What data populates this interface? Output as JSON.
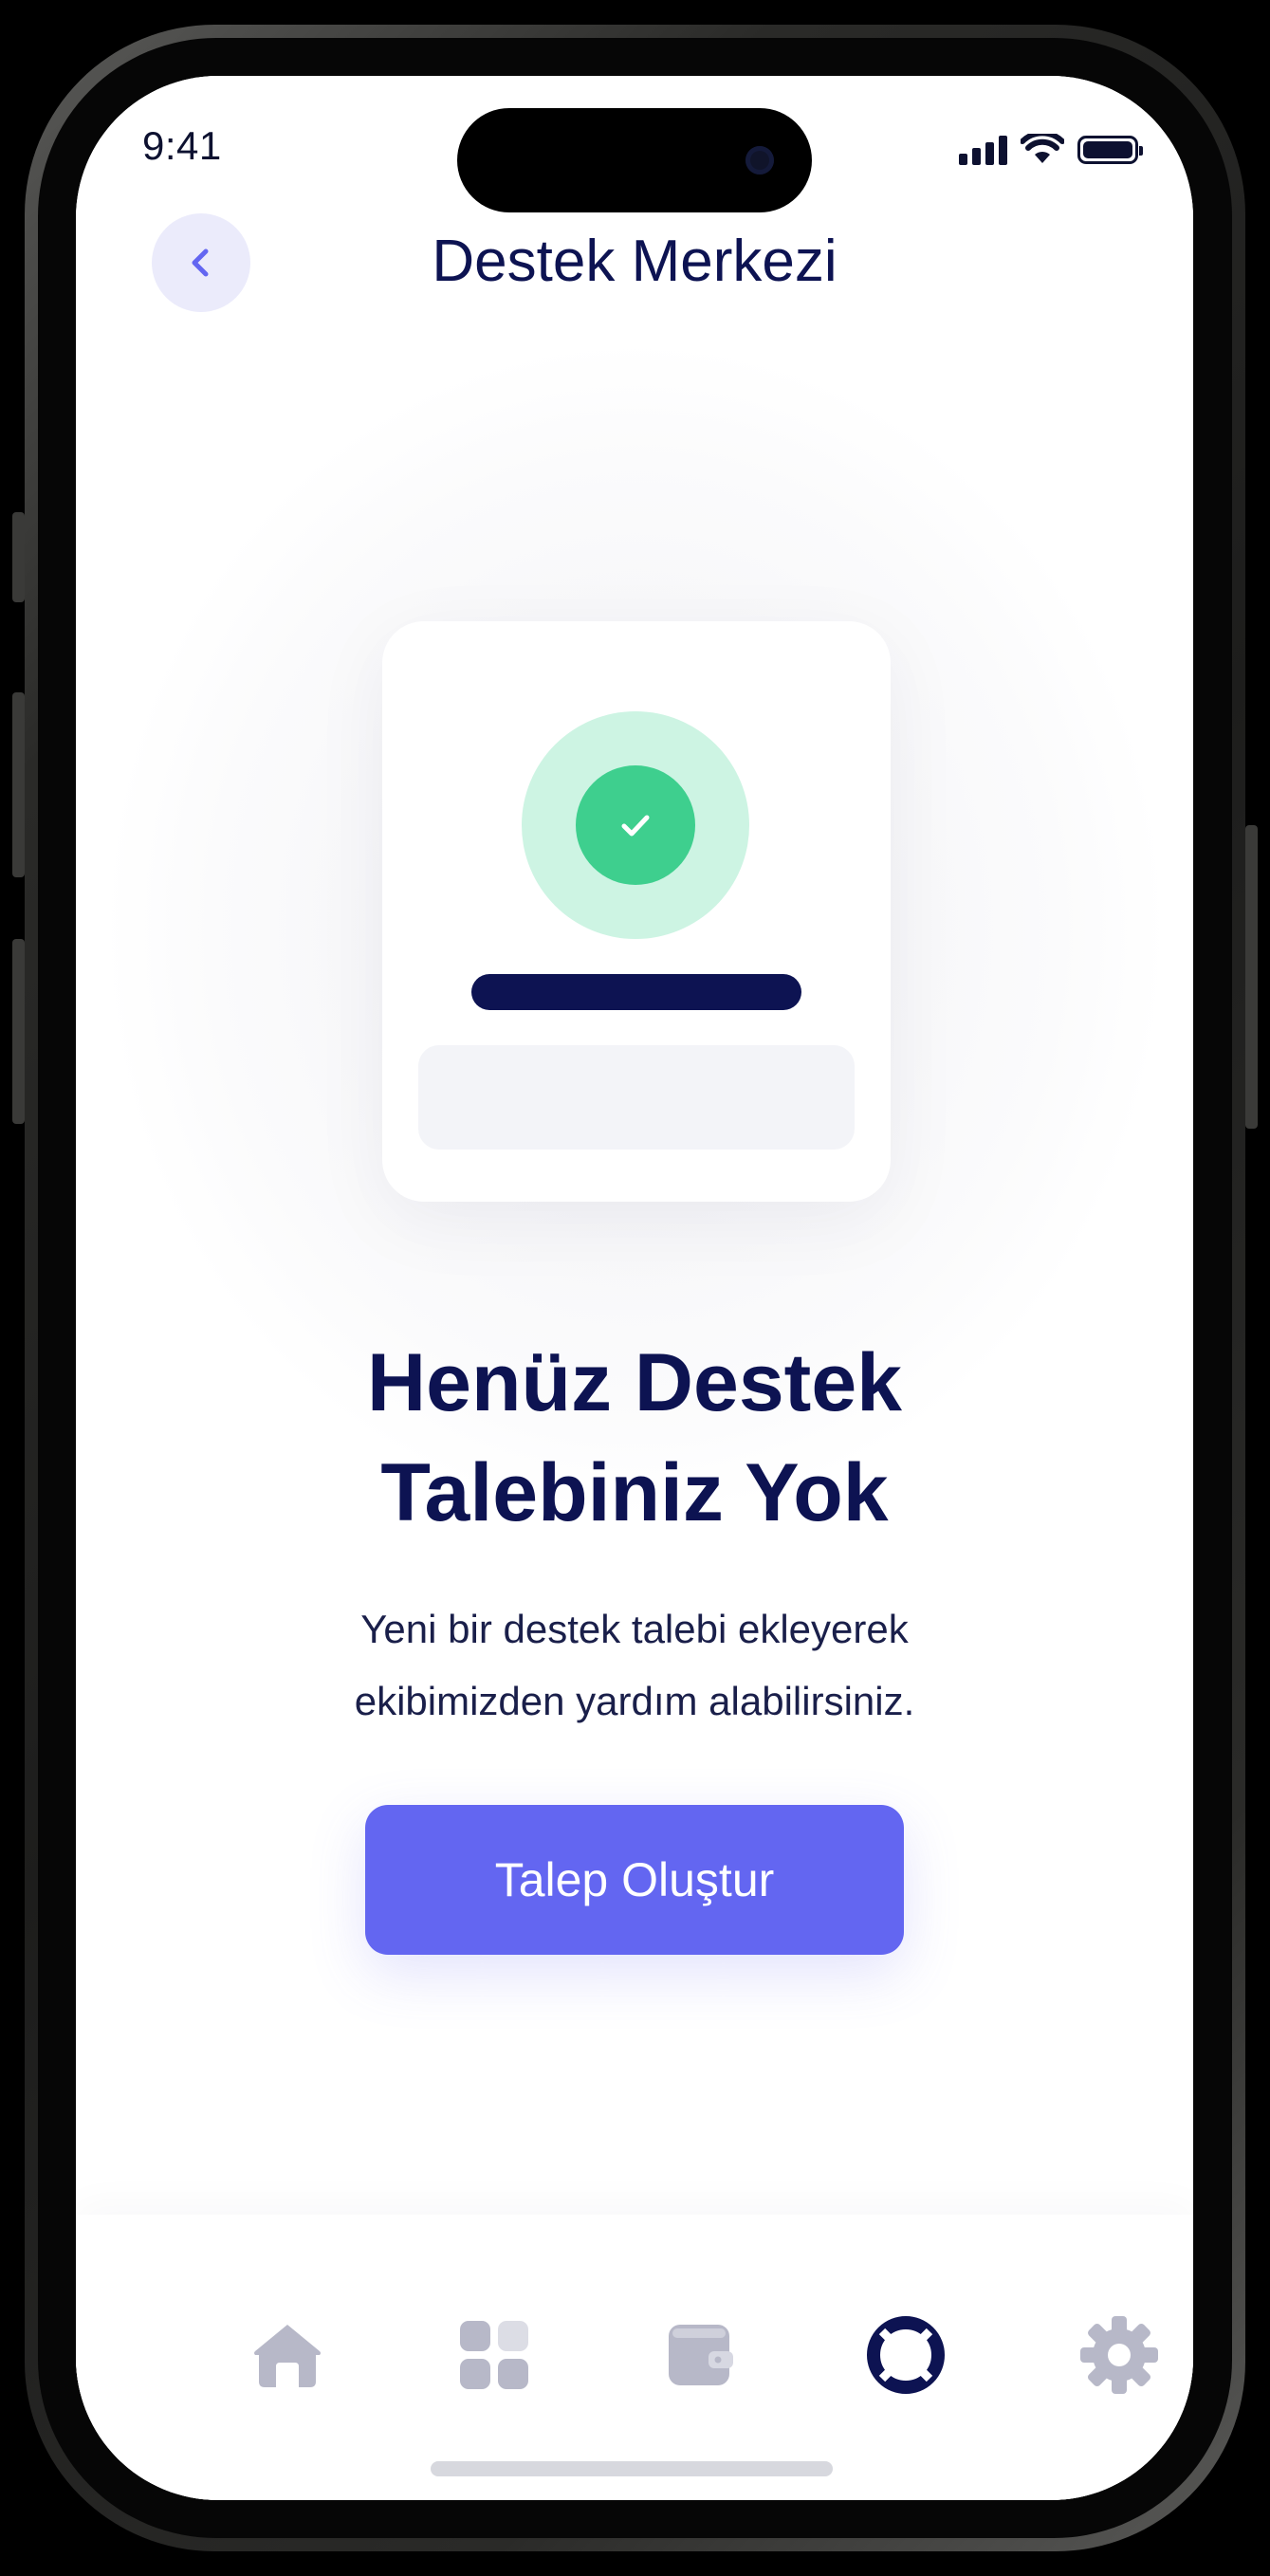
{
  "status_bar": {
    "time": "9:41"
  },
  "header": {
    "title": "Destek Merkezi",
    "back_icon": "chevron-left-icon"
  },
  "empty_state": {
    "illustration_icon": "check-circle-icon",
    "title_line1": "Henüz Destek",
    "title_line2": "Talebiniz Yok",
    "description_line1": "Yeni bir destek talebi ekleyerek",
    "description_line2": "ekibimizden yardım alabilirsiniz.",
    "cta_label": "Talep Oluştur"
  },
  "tab_bar": {
    "items": [
      {
        "icon": "home-icon",
        "active": false
      },
      {
        "icon": "grid-icon",
        "active": false
      },
      {
        "icon": "wallet-icon",
        "active": false
      },
      {
        "icon": "lifebuoy-icon",
        "active": true
      },
      {
        "icon": "gear-icon",
        "active": false
      }
    ]
  },
  "colors": {
    "accent": "#6366f1",
    "title": "#0d1352",
    "success": "#3ecf8e",
    "success_light": "#cdf4e3",
    "inactive_icon": "#b7b8c8",
    "back_button_bg": "#ebebfb"
  }
}
